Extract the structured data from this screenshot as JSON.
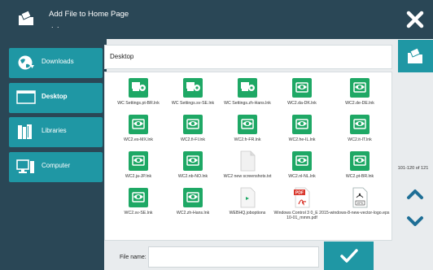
{
  "header": {
    "title": "Add File to Home Page",
    "subtitle": ". ."
  },
  "nav": {
    "items": [
      {
        "label": "Downloads"
      },
      {
        "label": "Desktop"
      },
      {
        "label": "Libraries"
      },
      {
        "label": "Computer"
      }
    ]
  },
  "path": {
    "current": "Desktop"
  },
  "pager": {
    "range": "101-120 of 121"
  },
  "files": [
    {
      "name": "WC Settings.pt-BR.lnk",
      "icon": "settings-app-icon"
    },
    {
      "name": "WC Settings.sv-SE.lnk",
      "icon": "settings-app-icon"
    },
    {
      "name": "WC Settings.zh-Hans.lnk",
      "icon": "settings-app-icon"
    },
    {
      "name": "WC2.da-DK.lnk",
      "icon": "wc2-app-icon"
    },
    {
      "name": "WC2.de-DE.lnk",
      "icon": "wc2-app-icon"
    },
    {
      "name": "WC2.es-MX.lnk",
      "icon": "wc2-app-icon"
    },
    {
      "name": "WC2.fi-FI.lnk",
      "icon": "wc2-app-icon"
    },
    {
      "name": "WC2.fr-FR.lnk",
      "icon": "wc2-app-icon"
    },
    {
      "name": "WC2.he-IL.lnk",
      "icon": "wc2-app-icon"
    },
    {
      "name": "WC2.it-IT.lnk",
      "icon": "wc2-app-icon"
    },
    {
      "name": "WC2.ja-JP.lnk",
      "icon": "wc2-app-icon"
    },
    {
      "name": "WC2.nb-NO.lnk",
      "icon": "wc2-app-icon"
    },
    {
      "name": "WC2 new screenshots.txt",
      "icon": "text-file-icon"
    },
    {
      "name": "WC2.nl-NL.lnk",
      "icon": "wc2-app-icon"
    },
    {
      "name": "WC2.pt-BR.lnk",
      "icon": "wc2-app-icon"
    },
    {
      "name": "WC2.sv-SE.lnk",
      "icon": "wc2-app-icon"
    },
    {
      "name": "WC2.zh-Hans.lnk",
      "icon": "wc2-app-icon"
    },
    {
      "name": "WEBHQ.joboptions",
      "icon": "joboptions-file-icon"
    },
    {
      "name": "Windows Control 3 0_E 2015-10-01_mmm.pdf",
      "icon": "pdf-file-icon"
    },
    {
      "name": "windows-8-new-vector-logo.eps",
      "icon": "eps-file-icon"
    }
  ],
  "footer": {
    "filename_label": "File name:",
    "filename_value": ""
  },
  "colors": {
    "header_bg": "#2a4756",
    "accent": "#1f97a4",
    "app_green": "#1ea865"
  }
}
